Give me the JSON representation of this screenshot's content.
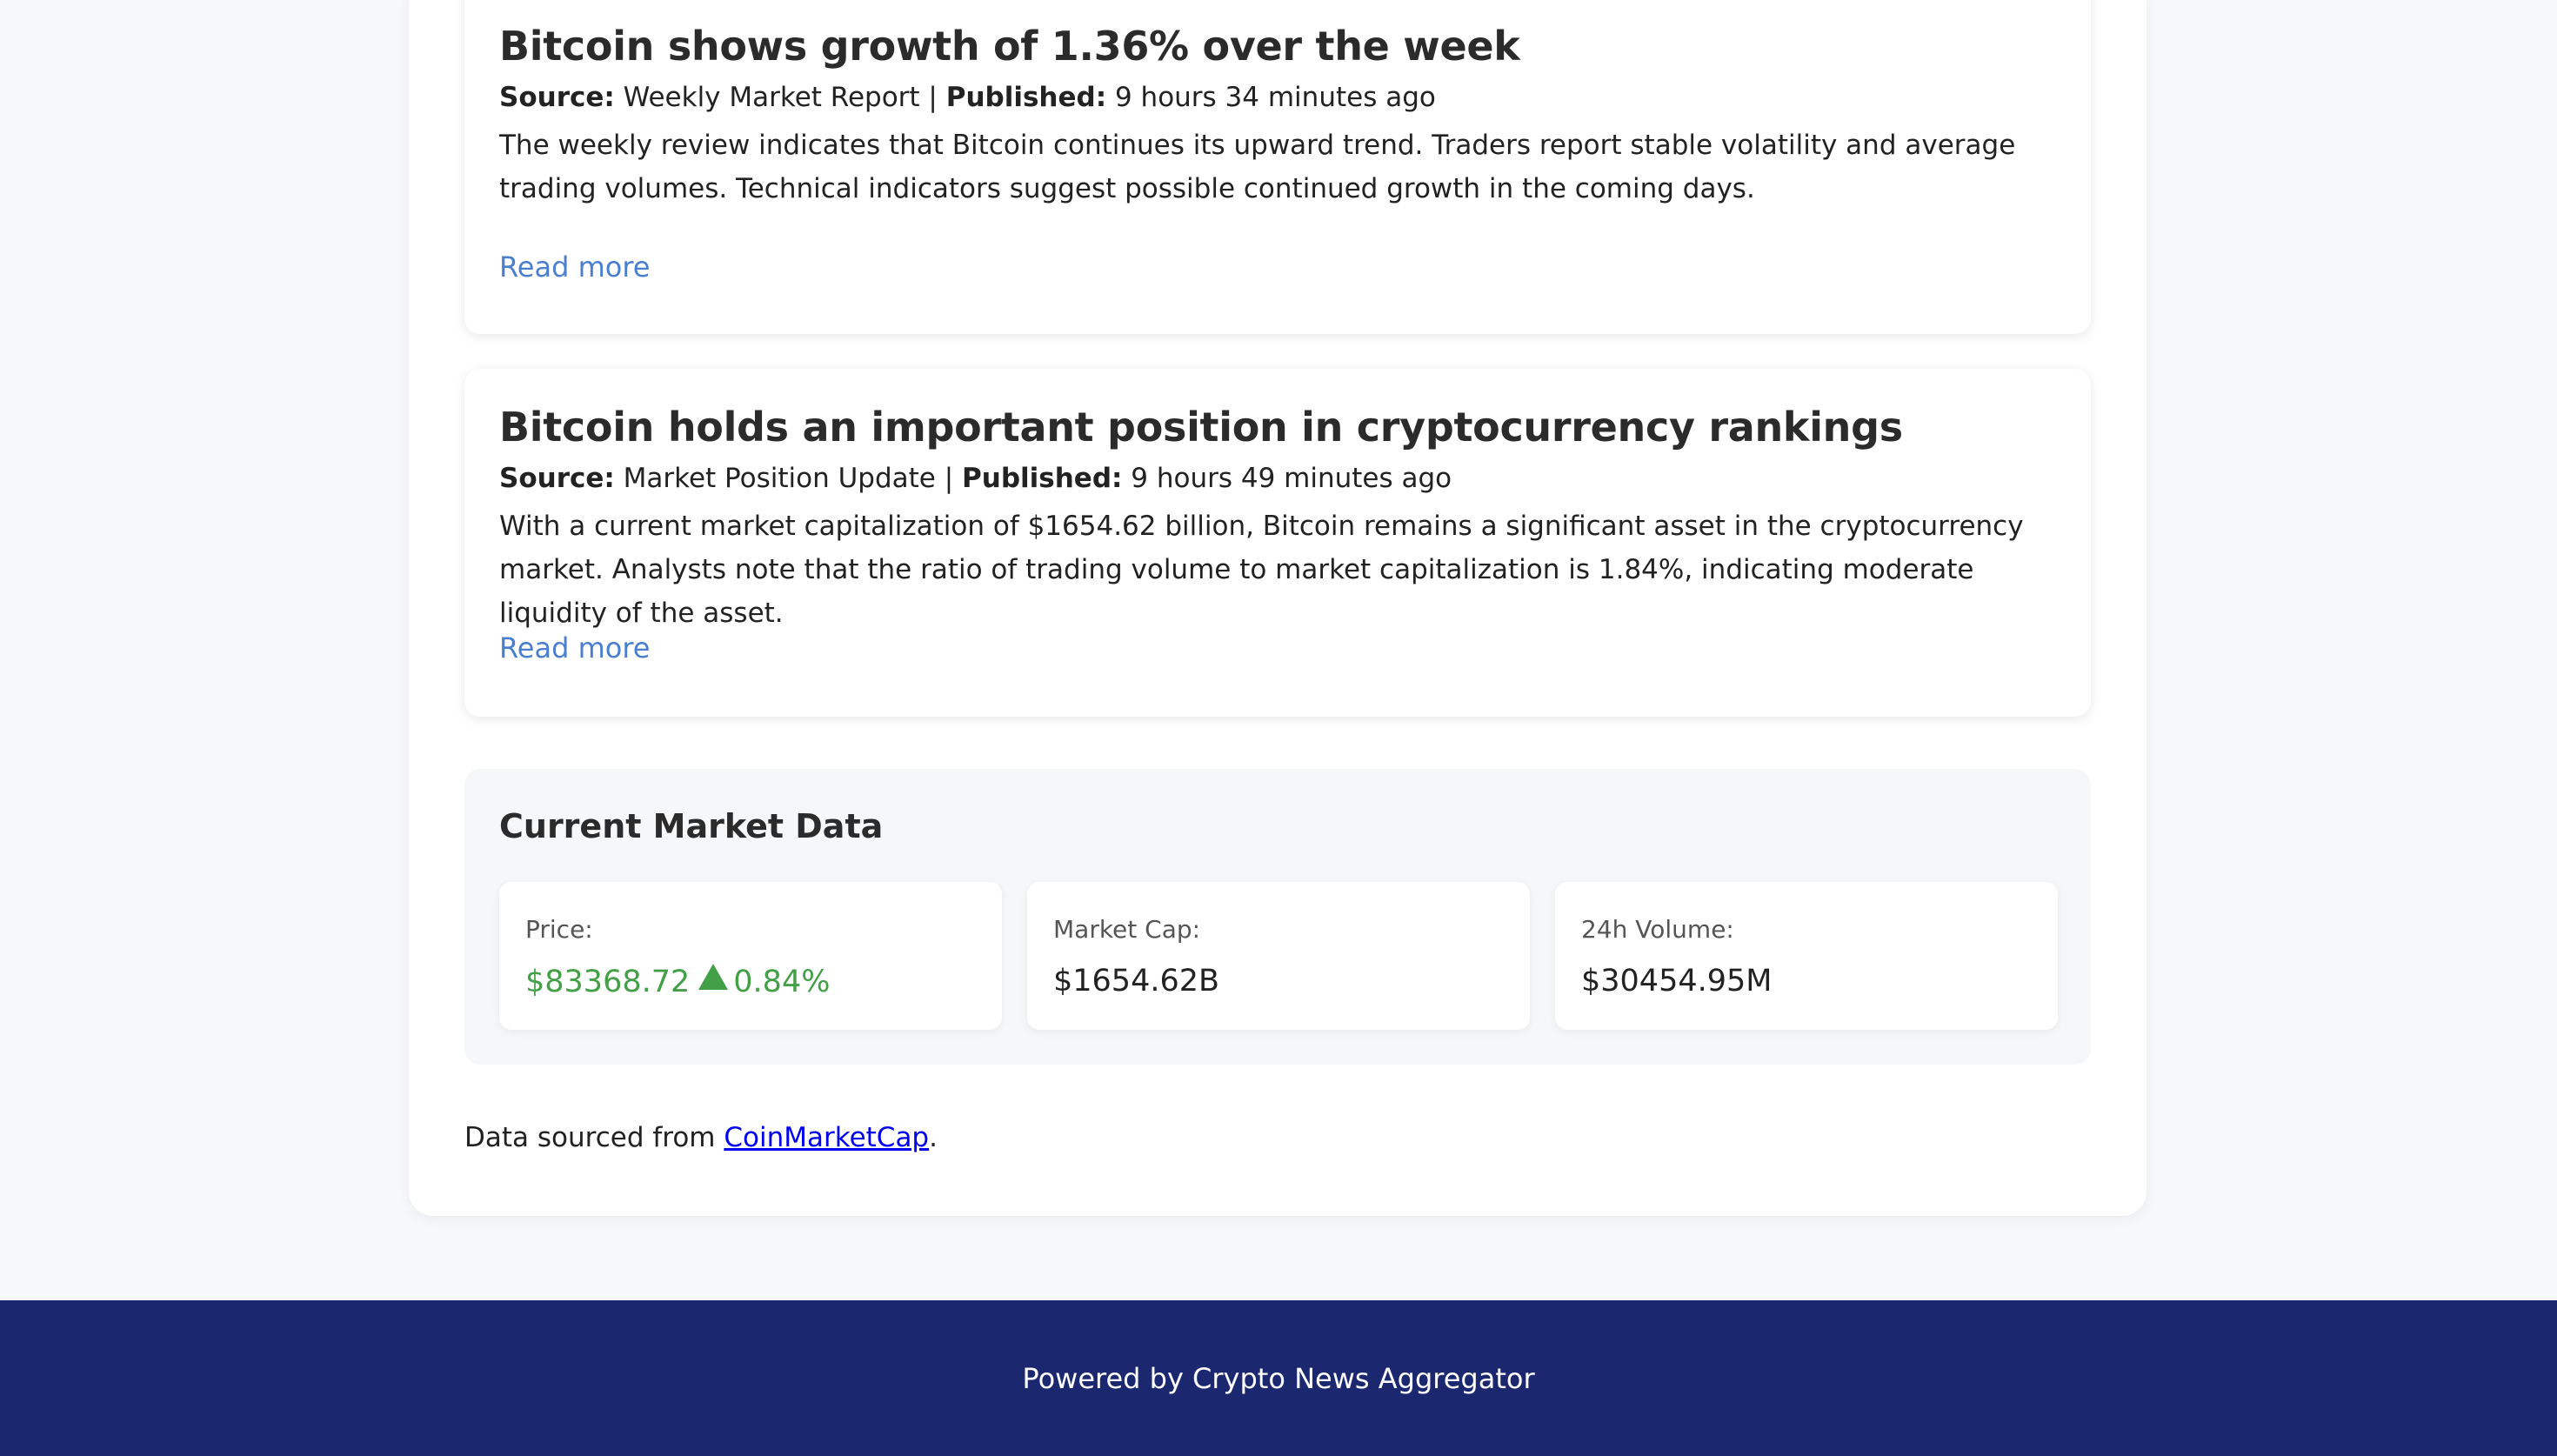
{
  "news": [
    {
      "title": "Bitcoin shows growth of 1.36% over the week",
      "source_label": "Source:",
      "source": "Weekly Market Report",
      "separator": " | ",
      "published_label": "Published:",
      "published": "9 hours 34 minutes ago",
      "body": "The weekly review indicates that Bitcoin continues its upward trend. Traders report stable volatility and average trading volumes. Technical indicators suggest possible continued growth in the coming days.",
      "read_more": "Read more"
    },
    {
      "title": "Bitcoin holds an important position in cryptocurrency rankings",
      "source_label": "Source:",
      "source": "Market Position Update",
      "separator": " | ",
      "published_label": "Published:",
      "published": "9 hours 49 minutes ago",
      "body": "With a current market capitalization of $1654.62 billion, Bitcoin remains a significant asset in the cryptocurrency market. Analysts note that the ratio of trading volume to market capitalization is 1.84%, indicating moderate liquidity of the asset.",
      "read_more": "Read more"
    }
  ],
  "market": {
    "title": "Current Market Data",
    "price_label": "Price:",
    "price": "$83368.72",
    "price_change": "0.84%",
    "price_trend": "up",
    "trend_icon": "triangle-up-icon",
    "cap_label": "Market Cap:",
    "cap": "$1654.62B",
    "volume_label": "24h Volume:",
    "volume": "$30454.95M"
  },
  "attribution": {
    "prefix": "Data sourced from ",
    "link": "CoinMarketCap",
    "suffix": "."
  },
  "footer": {
    "text": "Powered by Crypto News Aggregator"
  },
  "colors": {
    "accent_link": "#4a7fd0",
    "positive": "#43a047",
    "footer_bg": "#1b2870"
  }
}
